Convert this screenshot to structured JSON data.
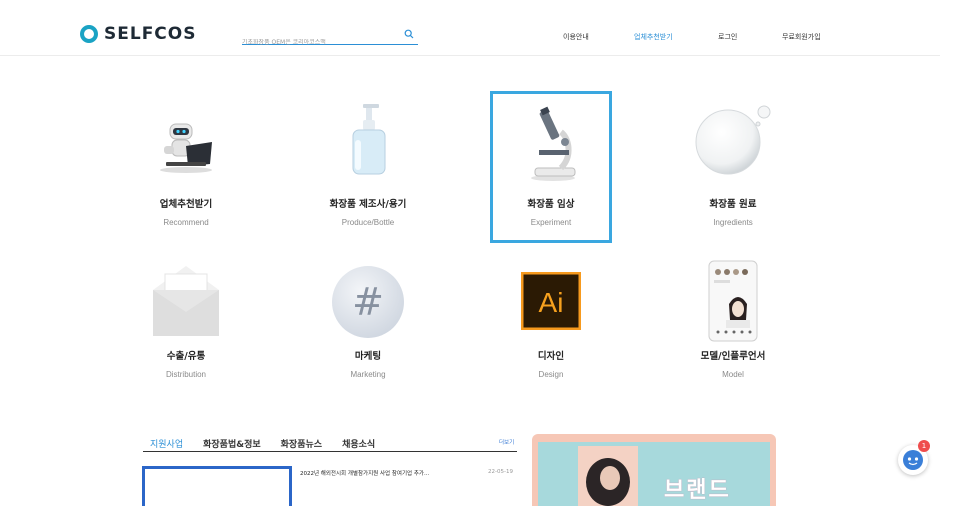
{
  "header": {
    "logo_text": "SELFCOS",
    "search_placeholder": "기초화장품 OEM은 코리아코스맥",
    "nav": [
      "이용안내",
      "업체추천받기",
      "로그인",
      "무료회원가입"
    ],
    "nav_active_index": 1
  },
  "categories": [
    {
      "title": "업체추천받기",
      "subtitle": "Recommend",
      "icon": "robot-laptop-icon"
    },
    {
      "title": "화장품 제조사/용기",
      "subtitle": "Produce/Bottle",
      "icon": "pump-bottle-icon"
    },
    {
      "title": "화장품 임상",
      "subtitle": "Experiment",
      "icon": "microscope-icon",
      "selected": true
    },
    {
      "title": "화장품 원료",
      "subtitle": "Ingredients",
      "icon": "water-drop-icon"
    },
    {
      "title": "수출/유통",
      "subtitle": "Distribution",
      "icon": "envelope-icon"
    },
    {
      "title": "마케팅",
      "subtitle": "Marketing",
      "icon": "hashtag-icon"
    },
    {
      "title": "디자인",
      "subtitle": "Design",
      "icon": "illustrator-ai-icon"
    },
    {
      "title": "모델/인플루언서",
      "subtitle": "Model",
      "icon": "phone-model-icon"
    }
  ],
  "board": {
    "tabs": [
      "지원사업",
      "화장품법&정보",
      "화장품뉴스",
      "채용소식"
    ],
    "active_tab": 0,
    "more_label": "더보기",
    "items": [
      {
        "title": "2022년 해외전시회 개별참가지원 사업 참여기업 추가...",
        "date": "22-05-19"
      }
    ]
  },
  "banner": {
    "text": "브랜드"
  },
  "chat": {
    "badge": "1"
  },
  "colors": {
    "accent": "#2b8fd6",
    "selected_border": "#3aa7e0",
    "logo": "#1aa3c4"
  }
}
